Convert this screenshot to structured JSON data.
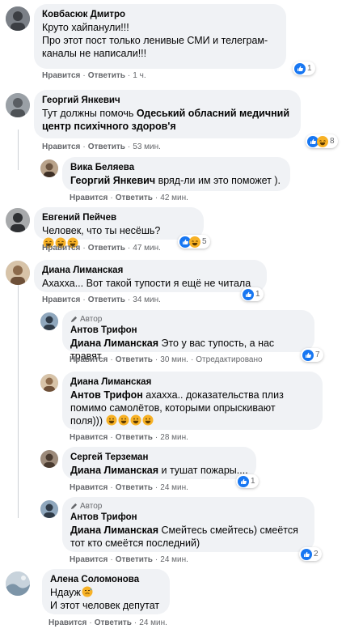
{
  "comments": [
    {
      "author": "Ковбасюк Дмитро",
      "line1": "Круто хайпанули!!!",
      "line2": "Про этот пост только ленивые СМИ и телеграм-",
      "line3": "каналы не написали!!!",
      "like": "Нравится",
      "reply": "Ответить",
      "time": "1 ч.",
      "reaction_count": "1"
    },
    {
      "author": "Георгий Янкевич",
      "line1_plain": "Тут должны помочь ",
      "line1_link": "Одеський обласний медичний",
      "line2_link": "центр психічного здоров'я",
      "like": "Нравится",
      "reply": "Ответить",
      "time": "53 мин.",
      "reaction_count": "8"
    },
    {
      "author": "Вика Беляева",
      "mention": "Георгий Янкевич",
      "text": " вряд-ли им это поможет ).",
      "like": "Нравится",
      "reply": "Ответить",
      "time": "42 мин."
    },
    {
      "author": "Евгений Пейчев",
      "text": "Человек, что ты несёшь?",
      "like": "Нравится",
      "reply": "Ответить",
      "time": "47 мин.",
      "reaction_count": "5"
    },
    {
      "author": "Диана Лиманская",
      "text": "Ахахха... Вот такой тупости я ещё не читала",
      "like": "Нравится",
      "reply": "Ответить",
      "time": "34 мин.",
      "reaction_count": "1"
    },
    {
      "badge": "Автор",
      "author": "Антов Трифон",
      "mention": "Диана Лиманская",
      "text": " Это у вас тупость, а нас травят",
      "like": "Нравится",
      "reply": "Ответить",
      "time": "30 мин.",
      "edited": "Отредактировано",
      "reaction_count": "7"
    },
    {
      "author": "Диана Лиманская",
      "mention": "Антов Трифон",
      "line1": " ахахха.. доказательства плиз",
      "line2": "помимо самолётов, которыми опрыскивают",
      "line3": "поля)))",
      "like": "Нравится",
      "reply": "Ответить",
      "time": "28 мин."
    },
    {
      "author": "Сергей Терземан",
      "mention": "Диана Лиманская",
      "text": " и тушат пожары....",
      "like": "Нравится",
      "reply": "Ответить",
      "time": "24 мин.",
      "reaction_count": "1"
    },
    {
      "badge": "Автор",
      "author": "Антов Трифон",
      "mention": "Диана Лиманская",
      "line1": " Смейтесь смейтесь) смеётся",
      "line2": "тот кто смеётся последний)",
      "like": "Нравится",
      "reply": "Ответить",
      "time": "24 мин.",
      "reaction_count": "2"
    },
    {
      "author": "Алена Соломонова",
      "line1": "Ндауж",
      "line2": "И этот человек депутат",
      "like": "Нравится",
      "reply": "Ответить",
      "time": "24 мин."
    }
  ],
  "colors": {
    "like_blue": "#1877f2",
    "haha_yellow": "#f7b125",
    "bubble": "#f0f2f5",
    "meta": "#65676b"
  }
}
